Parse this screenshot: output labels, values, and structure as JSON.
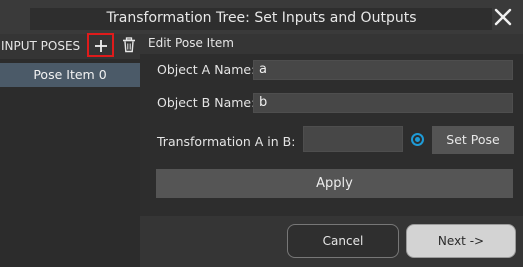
{
  "window": {
    "title": "Transformation Tree: Set Inputs and Outputs",
    "close_icon": "close-icon"
  },
  "left_panel": {
    "header": "INPUT POSES",
    "add_icon": "plus-icon",
    "delete_icon": "trash-icon",
    "items": [
      {
        "label": "Pose Item 0",
        "selected": true
      }
    ]
  },
  "edit_panel": {
    "title": "Edit Pose Item",
    "object_a_label": "Object A Name:",
    "object_a_value": "a",
    "object_b_label": "Object B Name:",
    "object_b_value": "b",
    "transform_label": "Transformation A in B:",
    "transform_value": "",
    "radio_checked": true,
    "set_pose_label": "Set Pose",
    "apply_label": "Apply"
  },
  "footer": {
    "cancel_label": "Cancel",
    "next_label": "Next ->"
  },
  "colors": {
    "accent": "#1e9bd7",
    "highlight_border": "#e01b1b",
    "selected_item": "#4b5a68"
  }
}
